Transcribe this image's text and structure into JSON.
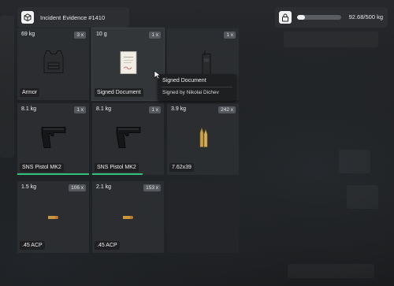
{
  "header": {
    "inventory_title": "Incident Evidence #1410",
    "weight_text": "92.68/500 kg",
    "weight_fraction": 0.185
  },
  "slots": [
    {
      "weight": "69 kg",
      "count": "3 x",
      "label": "Armor",
      "icon": "body-armor-icon"
    },
    {
      "weight": "10 g",
      "count": "1 x",
      "label": "Signed Document",
      "icon": "document-icon"
    },
    {
      "weight": "",
      "count": "1 x",
      "label": "",
      "icon": "radio-icon"
    },
    {
      "weight": "8.1 kg",
      "count": "1 x",
      "label": "SNS Pistol MK2",
      "icon": "pistol-icon",
      "durability": 1.0
    },
    {
      "weight": "8.1 kg",
      "count": "1 x",
      "label": "SNS Pistol MK2",
      "icon": "pistol-icon",
      "durability": 0.7
    },
    {
      "weight": "3.9 kg",
      "count": "242 x",
      "label": "7.62x39",
      "icon": "rifle-ammo-icon"
    },
    {
      "weight": "1.5 kg",
      "count": "106 x",
      "label": ".45 ACP",
      "icon": "pistol-ammo-icon"
    },
    {
      "weight": "2.1 kg",
      "count": "153 x",
      "label": ".45 ACP",
      "icon": "pistol-ammo-icon"
    }
  ],
  "tooltip": {
    "title": "Signed Document",
    "description": "Signed by Nikolai Dichev"
  }
}
